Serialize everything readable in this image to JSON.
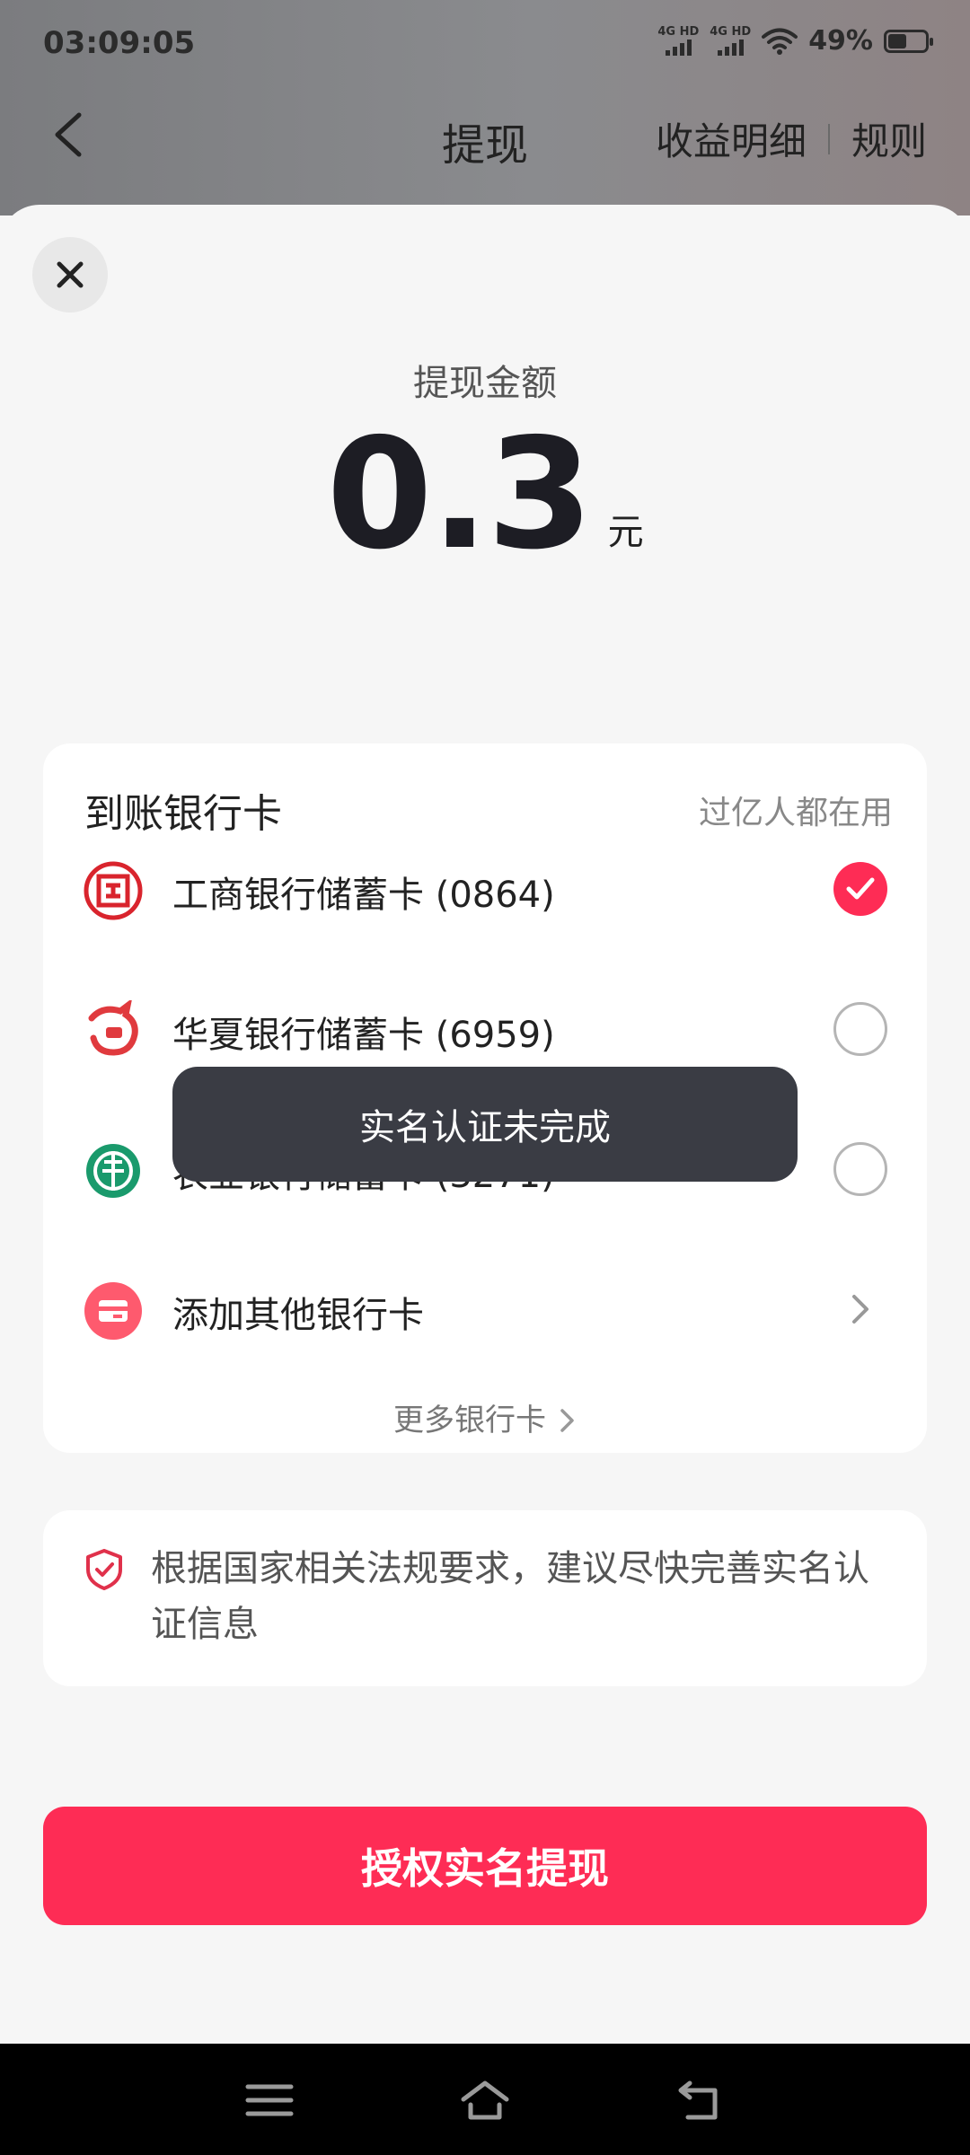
{
  "status_bar": {
    "time": "03:09:05",
    "signal1_label": "4G HD",
    "signal2_label": "4G HD",
    "battery_text": "49%",
    "battery_level": 0.49
  },
  "header": {
    "title": "提现",
    "link_earnings": "收益明细",
    "link_rules": "规则"
  },
  "amount": {
    "label": "提现金额",
    "value": "0.3",
    "unit": "元"
  },
  "bank_section": {
    "title": "到账银行卡",
    "tip": "过亿人都在用",
    "banks": [
      {
        "name": "工商银行储蓄卡 (0864)",
        "selected": true,
        "icon": "icbc-logo-icon",
        "color": "#d9242d"
      },
      {
        "name": "华夏银行储蓄卡 (6959)",
        "selected": false,
        "icon": "huaxia-logo-icon",
        "color": "#e03a3e"
      },
      {
        "name": "农业银行储蓄卡 (3271)",
        "selected": false,
        "icon": "abc-logo-icon",
        "color": "#1a9a6c"
      }
    ],
    "add_other": "添加其他银行卡",
    "more": "更多银行卡"
  },
  "notice": {
    "text": "根据国家相关法规要求，建议尽快完善实名认证信息"
  },
  "toast": {
    "text": "实名认证未完成"
  },
  "submit": {
    "label": "授权实名提现"
  },
  "colors": {
    "accent": "#fe2c55",
    "toast_bg": "#3a3c44"
  }
}
